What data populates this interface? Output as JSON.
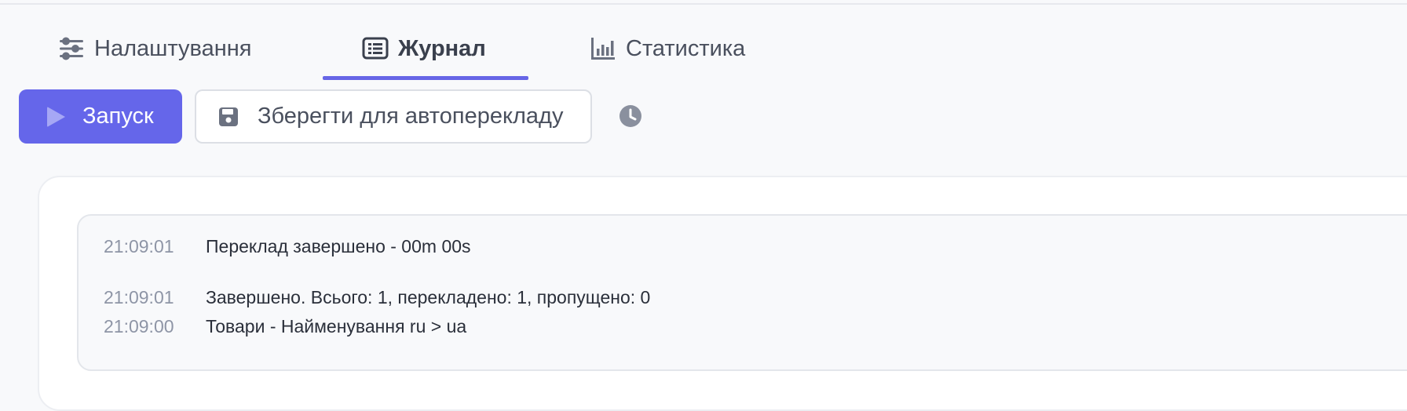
{
  "tabs": [
    {
      "label": "Налаштування",
      "icon": "sliders-icon",
      "active": false
    },
    {
      "label": "Журнал",
      "icon": "list-icon",
      "active": true
    },
    {
      "label": "Статистика",
      "icon": "bar-chart-icon",
      "active": false
    }
  ],
  "toolbar": {
    "start_label": "Запуск",
    "save_label": "Зберегти для автоперекладу",
    "history_icon": "clock-icon"
  },
  "colors": {
    "accent": "#6566ea",
    "tab_underline": "#6766e6"
  },
  "log": [
    {
      "time": "21:09:01",
      "message": "Переклад завершено - 00m 00s"
    },
    {
      "time": "21:09:01",
      "message": "Завершено. Всього: 1, перекладено: 1, пропущено: 0"
    },
    {
      "time": "21:09:00",
      "message": "Товари - Найменування ru > ua"
    }
  ]
}
